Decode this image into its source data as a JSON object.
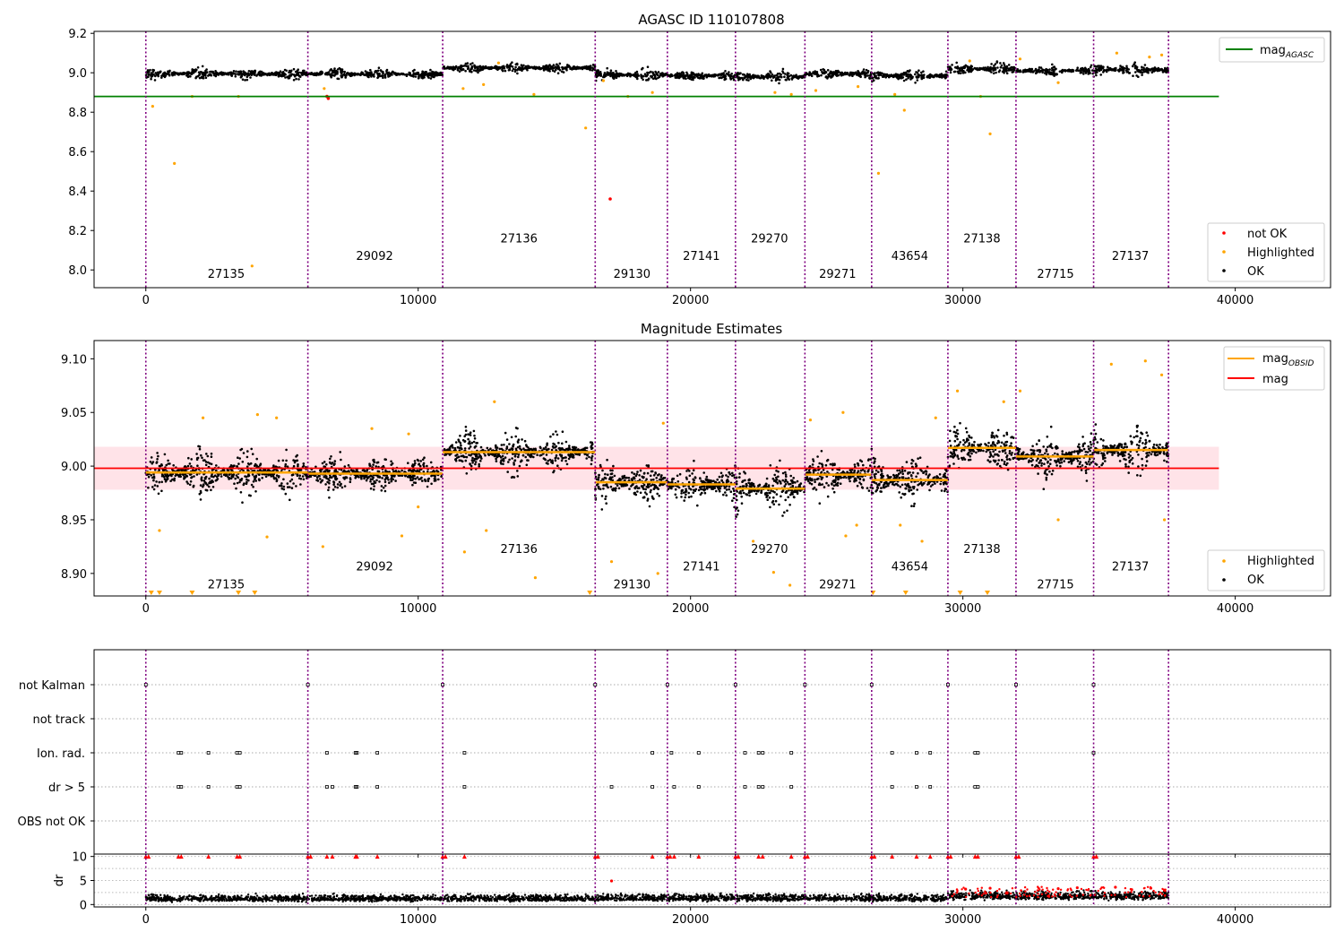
{
  "figure": {
    "background": "#ffffff"
  },
  "colors": {
    "ok": "#000000",
    "highlighted": "#ffa500",
    "not_ok": "#ff0000",
    "agasc": "#008000",
    "mag": "#ff0000",
    "obsid_mag": "#ffa500",
    "boundary": "#800080",
    "band": "#ffc0cb"
  },
  "chart_data": [
    {
      "type": "scatter",
      "title": "AGASC ID 110107808",
      "xlim": [
        -1900,
        43500
      ],
      "ylim": [
        7.91,
        9.21
      ],
      "xticks": [
        0,
        10000,
        20000,
        30000,
        40000
      ],
      "yticks": [
        8.0,
        8.2,
        8.4,
        8.6,
        8.8,
        9.0,
        9.2
      ],
      "ytick_labels": [
        "8.0",
        "8.2",
        "8.4",
        "8.6",
        "8.8",
        "9.0",
        "9.2"
      ],
      "grid": false,
      "obsid_boundaries": [
        0,
        5950,
        10900,
        16500,
        19150,
        21650,
        24200,
        26650,
        29450,
        31950,
        34800,
        37550
      ],
      "obsids": [
        {
          "label": "27135",
          "x": 2950,
          "y": 7.96
        },
        {
          "label": "29092",
          "x": 8400,
          "y": 8.05
        },
        {
          "label": "27136",
          "x": 13700,
          "y": 8.14
        },
        {
          "label": "29130",
          "x": 17850,
          "y": 7.96
        },
        {
          "label": "27141",
          "x": 20400,
          "y": 8.05
        },
        {
          "label": "29270",
          "x": 22900,
          "y": 8.14
        },
        {
          "label": "29271",
          "x": 25400,
          "y": 7.96
        },
        {
          "label": "43654",
          "x": 28050,
          "y": 8.05
        },
        {
          "label": "27138",
          "x": 30700,
          "y": 8.14
        },
        {
          "label": "27715",
          "x": 33400,
          "y": 7.96
        },
        {
          "label": "27137",
          "x": 36150,
          "y": 8.05
        }
      ],
      "agasc_mag_line": {
        "y": 8.88,
        "x": [
          -1900,
          39400
        ]
      },
      "series": [
        {
          "name": "mag_AGASC",
          "kind": "line",
          "color": "#008000"
        },
        {
          "name": "not OK",
          "kind": "points",
          "color": "#ff0000",
          "points": [
            [
              6700,
              8.87
            ],
            [
              17050,
              8.36
            ],
            [
              6650,
              8.88
            ]
          ]
        },
        {
          "name": "Highlighted",
          "kind": "points",
          "color": "#ffa500",
          "points": [
            [
              250,
              8.83
            ],
            [
              1050,
              8.54
            ],
            [
              3900,
              8.02
            ],
            [
              3400,
              8.88
            ],
            [
              6550,
              8.92
            ],
            [
              1700,
              8.88
            ],
            [
              16150,
              8.72
            ],
            [
              16800,
              8.96
            ],
            [
              14250,
              8.89
            ],
            [
              12400,
              8.94
            ],
            [
              11650,
              8.92
            ],
            [
              18600,
              8.9
            ],
            [
              24600,
              8.91
            ],
            [
              23100,
              8.9
            ],
            [
              23700,
              8.89
            ],
            [
              26150,
              8.93
            ],
            [
              26900,
              8.49
            ],
            [
              27500,
              8.89
            ],
            [
              27850,
              8.81
            ],
            [
              30650,
              8.88
            ],
            [
              31000,
              8.69
            ],
            [
              33500,
              8.95
            ],
            [
              32100,
              9.07
            ],
            [
              35650,
              9.1
            ],
            [
              36850,
              9.08
            ],
            [
              37300,
              9.09
            ],
            [
              17700,
              8.88
            ],
            [
              12950,
              9.05
            ],
            [
              30250,
              9.06
            ]
          ]
        },
        {
          "name": "OK",
          "kind": "band",
          "color": "#000000",
          "segments": [
            {
              "x0": 0,
              "x1": 5950,
              "center": 8.995,
              "spread": 0.05
            },
            {
              "x0": 5950,
              "x1": 10900,
              "center": 8.993,
              "spread": 0.045
            },
            {
              "x0": 10900,
              "x1": 16500,
              "center": 9.025,
              "spread": 0.045
            },
            {
              "x0": 16500,
              "x1": 19150,
              "center": 8.99,
              "spread": 0.05
            },
            {
              "x0": 19150,
              "x1": 21650,
              "center": 8.985,
              "spread": 0.05
            },
            {
              "x0": 21650,
              "x1": 24200,
              "center": 8.98,
              "spread": 0.05
            },
            {
              "x0": 24200,
              "x1": 26650,
              "center": 8.995,
              "spread": 0.05
            },
            {
              "x0": 26650,
              "x1": 29450,
              "center": 8.985,
              "spread": 0.055
            },
            {
              "x0": 29450,
              "x1": 31950,
              "center": 9.02,
              "spread": 0.05
            },
            {
              "x0": 31950,
              "x1": 34800,
              "center": 9.01,
              "spread": 0.05
            },
            {
              "x0": 34800,
              "x1": 37550,
              "center": 9.015,
              "spread": 0.06
            }
          ]
        }
      ],
      "legend_upper": {
        "position": "top-right",
        "entries": [
          "mag_AGASC"
        ]
      },
      "legend_lower": {
        "position": "bottom-right",
        "entries": [
          "not OK",
          "Highlighted",
          "OK"
        ]
      }
    },
    {
      "type": "scatter",
      "title": "Magnitude Estimates",
      "xlim": [
        -1900,
        43500
      ],
      "ylim": [
        8.879,
        9.117
      ],
      "xticks": [
        0,
        10000,
        20000,
        30000,
        40000
      ],
      "yticks": [
        8.9,
        8.95,
        9.0,
        9.05,
        9.1
      ],
      "ytick_labels": [
        "8.90",
        "8.95",
        "9.00",
        "9.05",
        "9.10"
      ],
      "grid": false,
      "mag_line": {
        "y": 8.998,
        "x": [
          -1900,
          39400
        ]
      },
      "mag_band": {
        "y0": 8.978,
        "y1": 9.018,
        "x": [
          -1900,
          39400
        ]
      },
      "obsids": [
        {
          "label": "27135",
          "x": 2950,
          "y": 8.886
        },
        {
          "label": "29092",
          "x": 8400,
          "y": 8.903
        },
        {
          "label": "27136",
          "x": 13700,
          "y": 8.919
        },
        {
          "label": "29130",
          "x": 17850,
          "y": 8.886
        },
        {
          "label": "27141",
          "x": 20400,
          "y": 8.903
        },
        {
          "label": "29270",
          "x": 22900,
          "y": 8.919
        },
        {
          "label": "29271",
          "x": 25400,
          "y": 8.886
        },
        {
          "label": "43654",
          "x": 28050,
          "y": 8.903
        },
        {
          "label": "27138",
          "x": 30700,
          "y": 8.919
        },
        {
          "label": "27715",
          "x": 33400,
          "y": 8.886
        },
        {
          "label": "27137",
          "x": 36150,
          "y": 8.903
        }
      ],
      "obsid_mags": [
        8.994,
        8.993,
        9.013,
        8.985,
        8.983,
        8.979,
        8.992,
        8.987,
        9.017,
        9.009,
        9.015
      ],
      "series": [
        {
          "name": "mag_OBSID",
          "kind": "line",
          "color": "#ffa500"
        },
        {
          "name": "mag",
          "kind": "line",
          "color": "#ff0000"
        },
        {
          "name": "Highlighted",
          "kind": "points",
          "color": "#ffa500",
          "points": [
            [
              500,
              8.94
            ],
            [
              2100,
              9.045
            ],
            [
              4100,
              9.048
            ],
            [
              4450,
              8.934
            ],
            [
              4800,
              9.045
            ],
            [
              6500,
              8.925
            ],
            [
              8300,
              9.035
            ],
            [
              9400,
              8.935
            ],
            [
              9650,
              9.03
            ],
            [
              10000,
              8.962
            ],
            [
              11700,
              8.92
            ],
            [
              12500,
              8.94
            ],
            [
              12800,
              9.06
            ],
            [
              14300,
              8.896
            ],
            [
              17100,
              8.911
            ],
            [
              18800,
              8.9
            ],
            [
              19000,
              9.04
            ],
            [
              22300,
              8.93
            ],
            [
              23050,
              8.901
            ],
            [
              23650,
              8.889
            ],
            [
              24400,
              9.043
            ],
            [
              25600,
              9.05
            ],
            [
              25700,
              8.935
            ],
            [
              26100,
              8.945
            ],
            [
              27700,
              8.945
            ],
            [
              28500,
              8.93
            ],
            [
              29000,
              9.045
            ],
            [
              29800,
              9.07
            ],
            [
              31500,
              9.06
            ],
            [
              32100,
              9.07
            ],
            [
              33500,
              8.95
            ],
            [
              35450,
              9.095
            ],
            [
              36700,
              9.098
            ],
            [
              37300,
              9.085
            ],
            [
              37400,
              8.95
            ]
          ]
        },
        {
          "name": "OK",
          "kind": "band",
          "color": "#000000",
          "segments": [
            {
              "x0": 0,
              "x1": 5950,
              "center": 8.994,
              "spread": 0.038
            },
            {
              "x0": 5950,
              "x1": 10900,
              "center": 8.993,
              "spread": 0.032
            },
            {
              "x0": 10900,
              "x1": 16500,
              "center": 9.013,
              "spread": 0.036
            },
            {
              "x0": 16500,
              "x1": 19150,
              "center": 8.985,
              "spread": 0.036
            },
            {
              "x0": 19150,
              "x1": 21650,
              "center": 8.983,
              "spread": 0.038
            },
            {
              "x0": 21650,
              "x1": 24200,
              "center": 8.979,
              "spread": 0.04
            },
            {
              "x0": 24200,
              "x1": 26650,
              "center": 8.992,
              "spread": 0.04
            },
            {
              "x0": 26650,
              "x1": 29450,
              "center": 8.987,
              "spread": 0.042
            },
            {
              "x0": 29450,
              "x1": 31950,
              "center": 9.017,
              "spread": 0.036
            },
            {
              "x0": 31950,
              "x1": 34800,
              "center": 9.009,
              "spread": 0.038
            },
            {
              "x0": 34800,
              "x1": 37550,
              "center": 9.015,
              "spread": 0.045
            }
          ]
        }
      ],
      "legend_upper": {
        "position": "top-right",
        "entries": [
          "mag_OBSID",
          "mag"
        ]
      },
      "legend_lower": {
        "position": "bottom-right",
        "entries": [
          "Highlighted",
          "OK"
        ]
      }
    },
    {
      "type": "scatter",
      "title": "",
      "xlim": [
        -1900,
        43500
      ],
      "flag_rows": [
        "not Kalman",
        "not track",
        "Ion. rad.",
        "dr > 5",
        "OBS not OK"
      ],
      "flag_events": {
        "not Kalman": [
          0,
          5950,
          10900,
          16500,
          19150,
          21650,
          24200,
          26650,
          29450,
          31950,
          34800
        ],
        "not track": [],
        "Ion. rad.": [
          1200,
          1300,
          2300,
          3350,
          3450,
          6650,
          7700,
          7750,
          8500,
          11700,
          18600,
          19300,
          20300,
          22000,
          22500,
          22650,
          23700,
          27400,
          28300,
          28800,
          30450,
          30550,
          34800
        ],
        "dr > 5": [
          1200,
          1300,
          2300,
          3350,
          3450,
          6650,
          6850,
          7700,
          7750,
          8500,
          11700,
          17100,
          18600,
          19400,
          20300,
          22000,
          22500,
          22650,
          23700,
          27400,
          28300,
          28800,
          30450,
          30550
        ],
        "OBS not OK": []
      },
      "dr_panel": {
        "ylabel": "dr",
        "ylim": [
          -0.5,
          10.5
        ],
        "yticks": [
          0,
          5,
          10
        ],
        "ytick_labels": [
          "0",
          "5",
          "10"
        ],
        "clipped_markers_x": [
          0,
          100,
          1200,
          1300,
          2300,
          3350,
          3450,
          5950,
          6050,
          6650,
          6850,
          7700,
          7750,
          8500,
          10900,
          11000,
          11700,
          16500,
          16600,
          18600,
          19150,
          19250,
          19400,
          20300,
          21650,
          21750,
          22500,
          22650,
          23700,
          24200,
          24300,
          26650,
          26750,
          27400,
          28300,
          28800,
          29450,
          29550,
          30450,
          30550,
          31950,
          32050,
          34800,
          34900
        ],
        "segments": [
          {
            "x0": 0,
            "x1": 16500,
            "center": 1.2,
            "spread": 1.4
          },
          {
            "x0": 16500,
            "x1": 26650,
            "center": 1.3,
            "spread": 1.5
          },
          {
            "x0": 26650,
            "x1": 29450,
            "center": 1.2,
            "spread": 1.4
          },
          {
            "x0": 29450,
            "x1": 37550,
            "center": 1.7,
            "spread": 1.8
          }
        ],
        "red_points": [
          [
            17100,
            4.9
          ],
          [
            30100,
            3.2
          ],
          [
            31000,
            3.4
          ],
          [
            33500,
            3.3
          ],
          [
            34200,
            3.5
          ],
          [
            35600,
            3.6
          ],
          [
            36200,
            3.1
          ],
          [
            36900,
            3.4
          ],
          [
            37400,
            3.0
          ]
        ]
      }
    }
  ]
}
